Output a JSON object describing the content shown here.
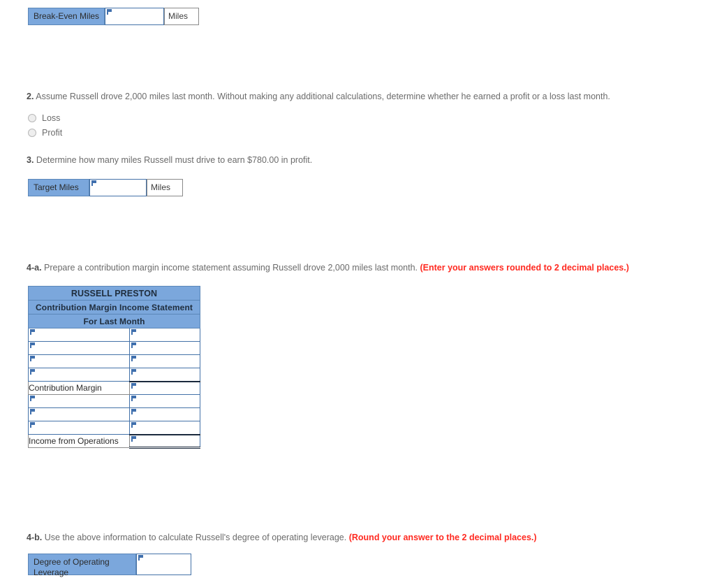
{
  "colors": {
    "header_blue": "#7BA7DC",
    "input_border_blue": "#4472a8",
    "note_red": "#ff2a21",
    "body_text": "#6b6b6b"
  },
  "break_even": {
    "label": "Break-Even Miles",
    "value": "",
    "unit": "Miles"
  },
  "question2": {
    "number": "2.",
    "text": "Assume Russell drove 2,000 miles last month. Without making any additional calculations, determine whether he earned a profit or a loss last month.",
    "options": [
      {
        "label": "Loss",
        "selected": false
      },
      {
        "label": "Profit",
        "selected": false
      }
    ]
  },
  "question3": {
    "number": "3.",
    "text": "Determine how many miles Russell must drive to earn $780.00 in profit.",
    "answer": {
      "label": "Target Miles",
      "value": "",
      "unit": "Miles"
    }
  },
  "question4a": {
    "number": "4-a.",
    "text": "Prepare a contribution margin income statement assuming Russell drove 2,000 miles last month.",
    "note": "(Enter your answers rounded to 2 decimal places.)",
    "statement": {
      "title_lines": [
        "RUSSELL PRESTON",
        "Contribution Margin Income Statement",
        "For Last Month"
      ],
      "rows": [
        {
          "label": "",
          "label_type": "input",
          "value": "",
          "amount": "",
          "amount_rule": "none"
        },
        {
          "label": "",
          "label_type": "input",
          "value": "",
          "amount": "",
          "amount_rule": "none"
        },
        {
          "label": "",
          "label_type": "input",
          "value": "",
          "amount": "",
          "amount_rule": "none"
        },
        {
          "label": "",
          "label_type": "input",
          "value": "",
          "amount": "",
          "amount_rule": "single"
        },
        {
          "label": "Contribution Margin",
          "label_type": "static",
          "value": "",
          "amount": "",
          "amount_rule": "none"
        },
        {
          "label": "",
          "label_type": "input",
          "value": "",
          "amount": "",
          "amount_rule": "none"
        },
        {
          "label": "",
          "label_type": "input",
          "value": "",
          "amount": "",
          "amount_rule": "none"
        },
        {
          "label": "",
          "label_type": "input",
          "value": "",
          "amount": "",
          "amount_rule": "single"
        },
        {
          "label": "Income from Operations",
          "label_type": "static",
          "value": "",
          "amount": "",
          "amount_rule": "double"
        }
      ]
    }
  },
  "question4b": {
    "number": "4-b.",
    "text": "Use the above information to calculate Russell's degree of operating leverage.",
    "note": "(Round your answer to the 2 decimal places.)",
    "answer": {
      "label": "Degree of Operating Leverage",
      "value": ""
    }
  }
}
